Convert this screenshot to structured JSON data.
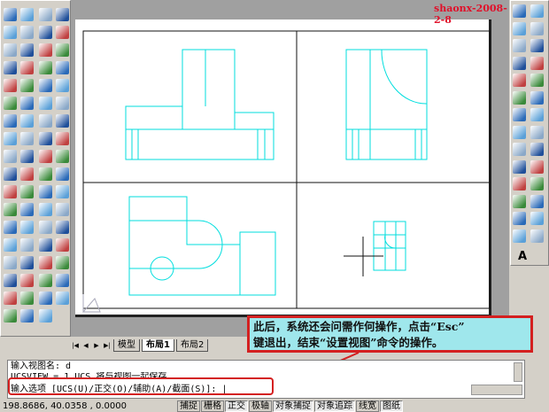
{
  "watermark": "shaonx-2008-2-8",
  "tabs": {
    "model": "模型",
    "layout1": "布局1",
    "layout2": "布局2"
  },
  "callout": {
    "line1": "此后，系统还会问需作何操作，点击“Esc”",
    "line2": "键退出，结束“设置视图”命令的操作。"
  },
  "command": {
    "history1": "输入视图名: d",
    "history2": "UCSVIEW = 1  UCS 将与视图一起保存",
    "prompt": "输入选项 [UCS(U)/正交(O)/辅助(A)/截面(S)]: |"
  },
  "status": {
    "coords": "198.8686, 40.0358 , 0.0000",
    "buttons": [
      "捕捉",
      "栅格",
      "正交",
      "极轴",
      "对象捕捉",
      "对象追踪",
      "线宽",
      "图纸"
    ]
  },
  "right_toolbar_text_icon": "A",
  "colors": {
    "drawing": "#00e5e5",
    "callout_bg": "#9fe7ec",
    "callout_border": "#d42020",
    "watermark": "#e0102a"
  }
}
